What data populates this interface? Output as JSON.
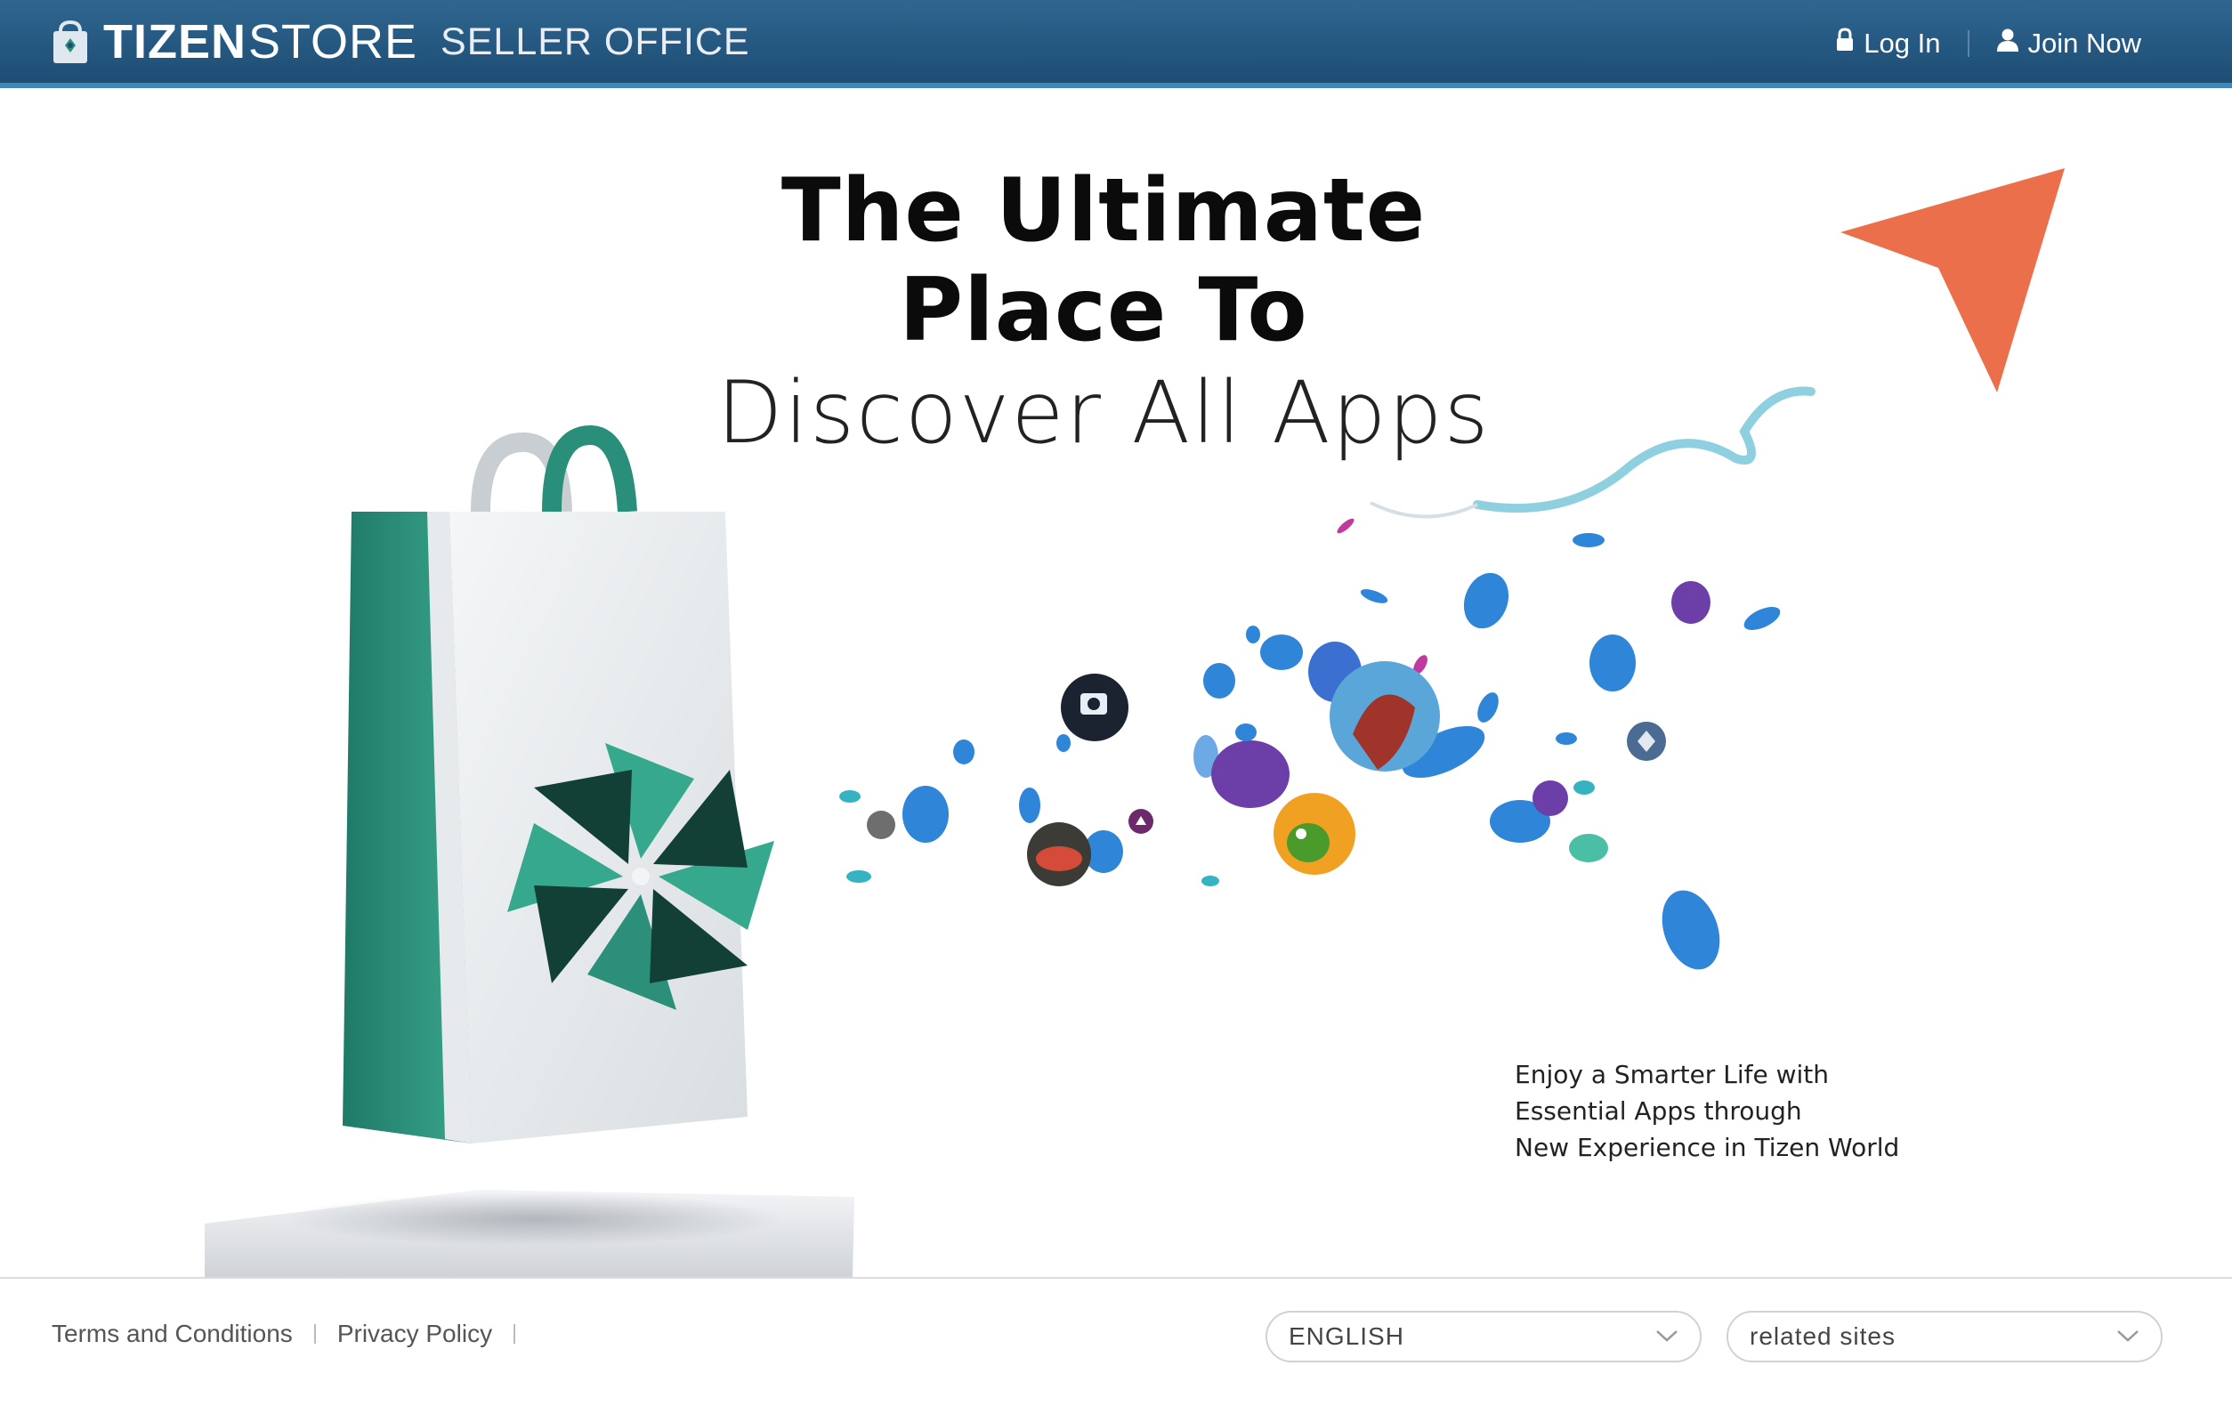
{
  "header": {
    "brand_bold": "TIZEN",
    "brand_light": "STORE",
    "brand_sub": "SELLER OFFICE",
    "login_label": "Log In",
    "join_label": "Join Now"
  },
  "hero": {
    "title_line1": "The Ultimate",
    "title_line2": "Place To",
    "title_line3": "Discover All Apps",
    "tagline": [
      "Enjoy a Smarter Life with",
      "Essential Apps through",
      "New Experience in Tizen World"
    ]
  },
  "footer": {
    "terms_label": "Terms and Conditions",
    "privacy_label": "Privacy Policy",
    "language_value": "ENGLISH",
    "related_value": "related sites"
  },
  "icons": {
    "login": "lock-icon",
    "join": "user-icon",
    "logo": "shopping-bag-icon",
    "select": "chevron-down-icon",
    "annotation": "pointer-arrow-icon"
  },
  "colors": {
    "header_bg": "#1d4d74",
    "header_accent": "#3f88b7",
    "brand_teal": "#2a8f7a",
    "bubble_blue": "#2f86d8",
    "annotation_arrow": "#ec6f4b"
  }
}
